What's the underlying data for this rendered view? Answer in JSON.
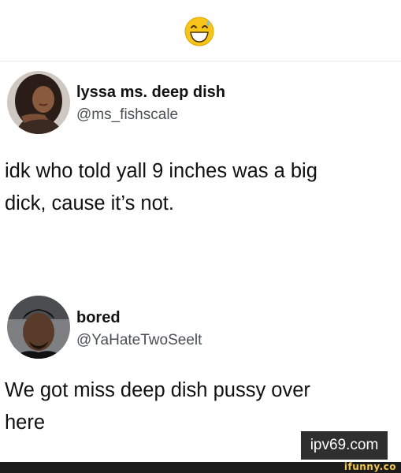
{
  "header": {
    "emoji": "grinning-sweat-face"
  },
  "tweets": [
    {
      "name": "lyssa ms. deep dish",
      "handle": "@ms_fishscale",
      "text_line1": "idk who told yall 9 inches was a big",
      "text_line2": "dick, cause it’s not."
    },
    {
      "name": "bored",
      "handle": "@YaHateTwoSeelt",
      "text_line1": "We got miss deep dish pussy over",
      "text_line2": "here"
    }
  ],
  "watermark": {
    "site": "ipv69.com"
  },
  "footer": {
    "logo": "ifunny.co"
  },
  "colors": {
    "text": "#111111",
    "handle": "#4a4f54",
    "emoji_yellow": "#f5c518",
    "ifunny_yellow": "#f2c744"
  }
}
